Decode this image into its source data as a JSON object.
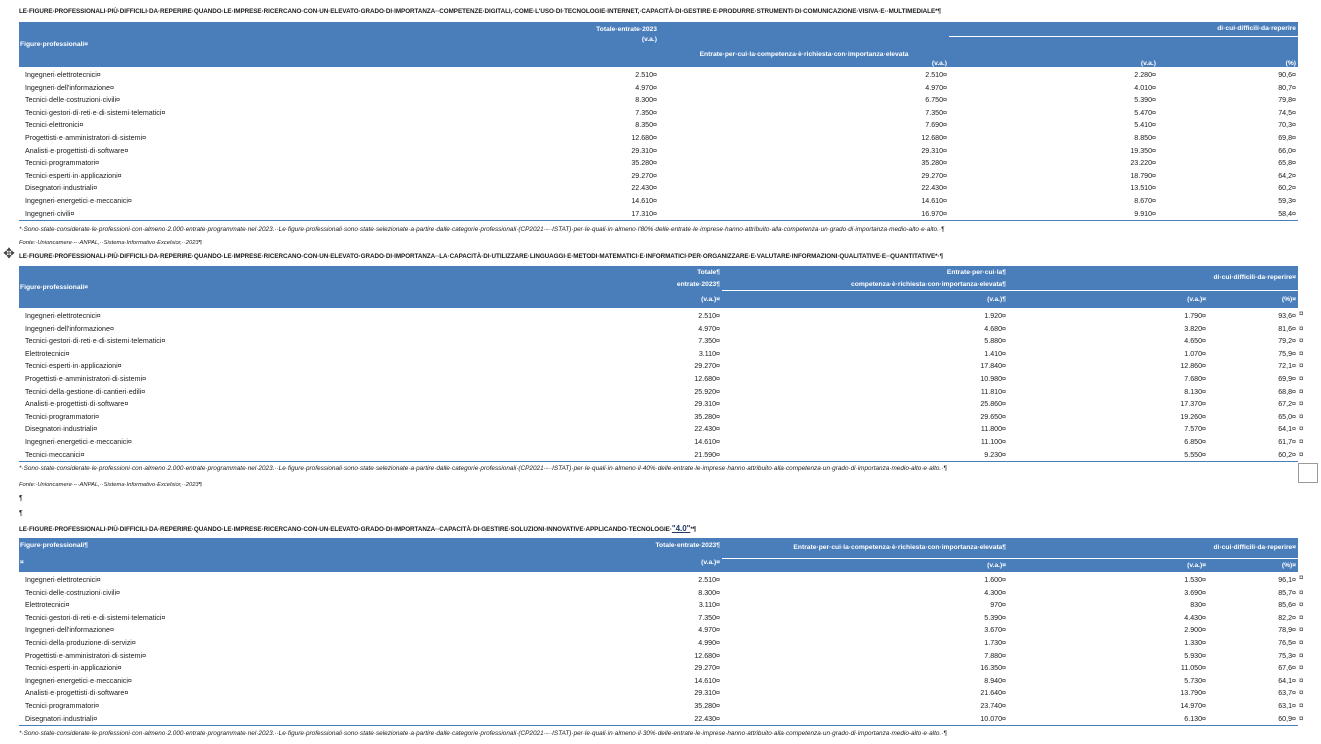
{
  "tables": [
    {
      "title": "LE·FIGURE·PROFESSIONALI·PIÙ·DIFFICILI·DA·REPERIRE·QUANDO·LE·IMPRESE·RICERCANO·CON·UN·ELEVATO·GRADO·DI·IMPORTANZA··COMPETENZE·DIGITALI,·COME·L'USO·DI·TECNOLOGIE·INTERNET,·CAPACITÀ·DI·GESTIRE·E·PRODURRE·STRUMENTI·DI·COMUNICAZIONE·VISIVA·E··MULTIMEDIALE*¶",
      "headers": {
        "col1": "Figure·professionali¤",
        "col2a": "Totale·entrate·2023",
        "col2b": "(v.a.)",
        "col3a": "Entrate·per·cui·la·competenza·è·richiesta·con·importanza·elevata",
        "col3b": "(v.a.)",
        "col45": "di·cui·difficili·da·reperire",
        "col4": "(v.a.)",
        "col5": "(%)"
      },
      "rows": [
        [
          "Ingegneri·elettrotecnici¤",
          "2.510¤",
          "2.510¤",
          "2.280¤",
          "90,6¤"
        ],
        [
          "Ingegneri·dell'informazione¤",
          "4.970¤",
          "4.970¤",
          "4.010¤",
          "80,7¤"
        ],
        [
          "Tecnici·delle·costruzioni·civili¤",
          "8.300¤",
          "6.750¤",
          "5.390¤",
          "79,8¤"
        ],
        [
          "Tecnici·gestori·di·reti·e·di·sistemi·telematici¤",
          "7.350¤",
          "7.350¤",
          "5.470¤",
          "74,5¤"
        ],
        [
          "Tecnici·elettronici¤",
          "8.350¤",
          "7.690¤",
          "5.410¤",
          "70,3¤"
        ],
        [
          "Progettisti·e·amministratori·di·sistemi¤",
          "12.680¤",
          "12.680¤",
          "8.850¤",
          "69,8¤"
        ],
        [
          "Analisti·e·progettisti·di·software¤",
          "29.310¤",
          "29.310¤",
          "19.350¤",
          "66,0¤"
        ],
        [
          "Tecnici·programmatori¤",
          "35.280¤",
          "35.280¤",
          "23.220¤",
          "65,8¤"
        ],
        [
          "Tecnici·esperti·in·applicazioni¤",
          "29.270¤",
          "29.270¤",
          "18.790¤",
          "64,2¤"
        ],
        [
          "Disegnatori·industriali¤",
          "22.430¤",
          "22.430¤",
          "13.510¤",
          "60,2¤"
        ],
        [
          "Ingegneri·energetici·e·meccanici¤",
          "14.610¤",
          "14.610¤",
          "8.670¤",
          "59,3¤"
        ],
        [
          "Ingegneri·civili¤",
          "17.310¤",
          "16.970¤",
          "9.910¤",
          "58,4¤"
        ]
      ],
      "note": "*·Sono·state·considerate·le·professioni·con·almeno·2.000·entrate·programmate·nel·2023.··Le·figure·professionali·sono·state·selezionate·a·partire·dalle·categorie·professionali·(CP2021·-··ISTAT)·per·le·quali·in·almeno·l'80%·delle·entrate·le·imprese·hanno·attribuito·alla·competenza·un·grado·di·importanza·medio-alto·e·alto.·¶",
      "source": "Fonte:·Unioncamere·-··ANPAL,··Sistema·Informativo·Excelsior,··2023¶"
    },
    {
      "title": "LE·FIGURE·PROFESSIONALI·PIÙ·DIFFICILI·DA·REPERIRE·QUANDO·LE·IMPRESE·RICERCANO·CON·UN·ELEVATO·GRADO·DI·IMPORTANZA··LA·CAPACITÀ·DI·UTILIZZARE·LINGUAGGI·E·METODI·MATEMATICI·E·INFORMATICI·PER·ORGANIZZARE·E·VALUTARE·INFORMAZIONI·QUALITATIVE·E··QUANTITATIVE*·¶",
      "headers": {
        "col1": "Figure·professionali¤",
        "col2a": "Totale¶",
        "col2b": "entrate·2023¶",
        "col2c": "(v.a.)¤",
        "col3a": "Entrate·per·cui·la¶",
        "col3b": "competenza·è·richiesta·con·importanza·elevata¶",
        "col3c": "(v.a.)¶",
        "col45": "di·cui·difficili·da·reperire¤",
        "col4": "(v.a.)¤",
        "col5": "(%)¤"
      },
      "rows": [
        [
          "Ingegneri·elettrotecnici¤",
          "2.510¤",
          "1.920¤",
          "1.790¤",
          "93,6¤"
        ],
        [
          "Ingegneri·dell'informazione¤",
          "4.970¤",
          "4.680¤",
          "3.820¤",
          "81,6¤"
        ],
        [
          "Tecnici·gestori·di·reti·e·di·sistemi·telematici¤",
          "7.350¤",
          "5.880¤",
          "4.650¤",
          "79,2¤"
        ],
        [
          "Elettrotecnici¤",
          "3.110¤",
          "1.410¤",
          "1.070¤",
          "75,9¤"
        ],
        [
          "Tecnici·esperti·in·applicazioni¤",
          "29.270¤",
          "17.840¤",
          "12.860¤",
          "72,1¤"
        ],
        [
          "Progettisti·e·amministratori·di·sistemi¤",
          "12.680¤",
          "10.980¤",
          "7.680¤",
          "69,9¤"
        ],
        [
          "Tecnici·della·gestione·di·cantieri·edili¤",
          "25.920¤",
          "11.810¤",
          "8.130¤",
          "68,8¤"
        ],
        [
          "Analisti·e·progettisti·di·software¤",
          "29.310¤",
          "25.860¤",
          "17.370¤",
          "67,2¤"
        ],
        [
          "Tecnici·programmatori¤",
          "35.280¤",
          "29.650¤",
          "19.260¤",
          "65,0¤"
        ],
        [
          "Disegnatori·industriali¤",
          "22.430¤",
          "11.800¤",
          "7.570¤",
          "64,1¤"
        ],
        [
          "Ingegneri·energetici·e·meccanici¤",
          "14.610¤",
          "11.100¤",
          "6.850¤",
          "61,7¤"
        ],
        [
          "Tecnici·meccanici¤",
          "21.590¤",
          "9.230¤",
          "5.550¤",
          "60,2¤"
        ]
      ],
      "note": "*·Sono·state·considerate·le·professioni·con·almeno·2.000·entrate·programmate·nel·2023.··Le·figure·professionali·sono·state·selezionate·a·partire·dalle·categorie·professionali·(CP2021·-··ISTAT)·per·le·quali·in·almeno·il·40%·delle·entrate·le·imprese·hanno·attribuito·alla·competenza·un·grado·di·importanza·medio-alto·e·alto.·¶",
      "source": "Fonte:·Unioncamere·-··ANPAL,··Sistema·Informativo·Excelsior,··2023¶"
    },
    {
      "title": "LE·FIGURE·PROFESSIONALI·PIÙ·DIFFICILI·DA·REPERIRE·QUANDO·LE·IMPRESE·RICERCANO·CON·UN·ELEVATO·GRADO·DI·IMPORTANZA··CAPACITÀ·DI·GESTIRE·SOLUZIONI·INNOVATIVE·APPLICANDO·TECNOLOGIE·",
      "title_emph": "\"4.0\"",
      "title_end": "*¶",
      "headers": {
        "col1": "Figure·professionali¶",
        "col1b": "¤",
        "col2a": "Totale·entrate·2023¶",
        "col2b": "(v.a.)¤",
        "col3a": "Entrate·per·cui·la·competenza·è·richiesta·con·importanza·elevata¶",
        "col3b": "(v.a.)¤",
        "col45": "di·cui·difficili·da·reperire¤",
        "col4": "(v.a.)¤",
        "col5": "(%)¤"
      },
      "rows": [
        [
          "Ingegneri·elettrotecnici¤",
          "2.510¤",
          "1.600¤",
          "1.530¤",
          "96,1¤"
        ],
        [
          "Tecnici·delle·costruzioni·civili¤",
          "8.300¤",
          "4.300¤",
          "3.690¤",
          "85,7¤"
        ],
        [
          "Elettrotecnici¤",
          "3.110¤",
          "970¤",
          "830¤",
          "85,6¤"
        ],
        [
          "Tecnici·gestori·di·reti·e·di·sistemi·telematici¤",
          "7.350¤",
          "5.390¤",
          "4.430¤",
          "82,2¤"
        ],
        [
          "Ingegneri·dell'informazione¤",
          "4.970¤",
          "3.670¤",
          "2.900¤",
          "78,9¤"
        ],
        [
          "Tecnici·della·produzione·di·servizi¤",
          "4.990¤",
          "1.730¤",
          "1.330¤",
          "76,5¤"
        ],
        [
          "Progettisti·e·amministratori·di·sistemi¤",
          "12.680¤",
          "7.880¤",
          "5.930¤",
          "75,3¤"
        ],
        [
          "Tecnici·esperti·in·applicazioni¤",
          "29.270¤",
          "16.350¤",
          "11.050¤",
          "67,6¤"
        ],
        [
          "Ingegneri·energetici·e·meccanici¤",
          "14.610¤",
          "8.940¤",
          "5.730¤",
          "64,1¤"
        ],
        [
          "Analisti·e·progettisti·di·software¤",
          "29.310¤",
          "21.640¤",
          "13.790¤",
          "63,7¤"
        ],
        [
          "Tecnici·programmatori¤",
          "35.280¤",
          "23.740¤",
          "14.970¤",
          "63,1¤"
        ],
        [
          "Disegnatori·industriali¤",
          "22.430¤",
          "10.070¤",
          "6.130¤",
          "60,9¤"
        ]
      ],
      "note": "*·Sono·state·considerate·le·professioni·con·almeno·2.000·entrate·programmate·nel·2023.··Le·figure·professionali·sono·state·selezionate·a·partire·dalle·categorie·professionali·(CP2021·-··ISTAT)·per·le·quali·in·almeno·il·30%·delle·entrate·le·imprese·hanno·attribuito·alla·competenza·un·grado·di·importanza·medio-alto·e·alto.·¶"
    }
  ],
  "pilcrows": [
    "¶",
    "¶"
  ],
  "end_mark": "¤",
  "colors": {
    "header_bg": "#4a7ebb",
    "header_text": "#ffffff"
  }
}
